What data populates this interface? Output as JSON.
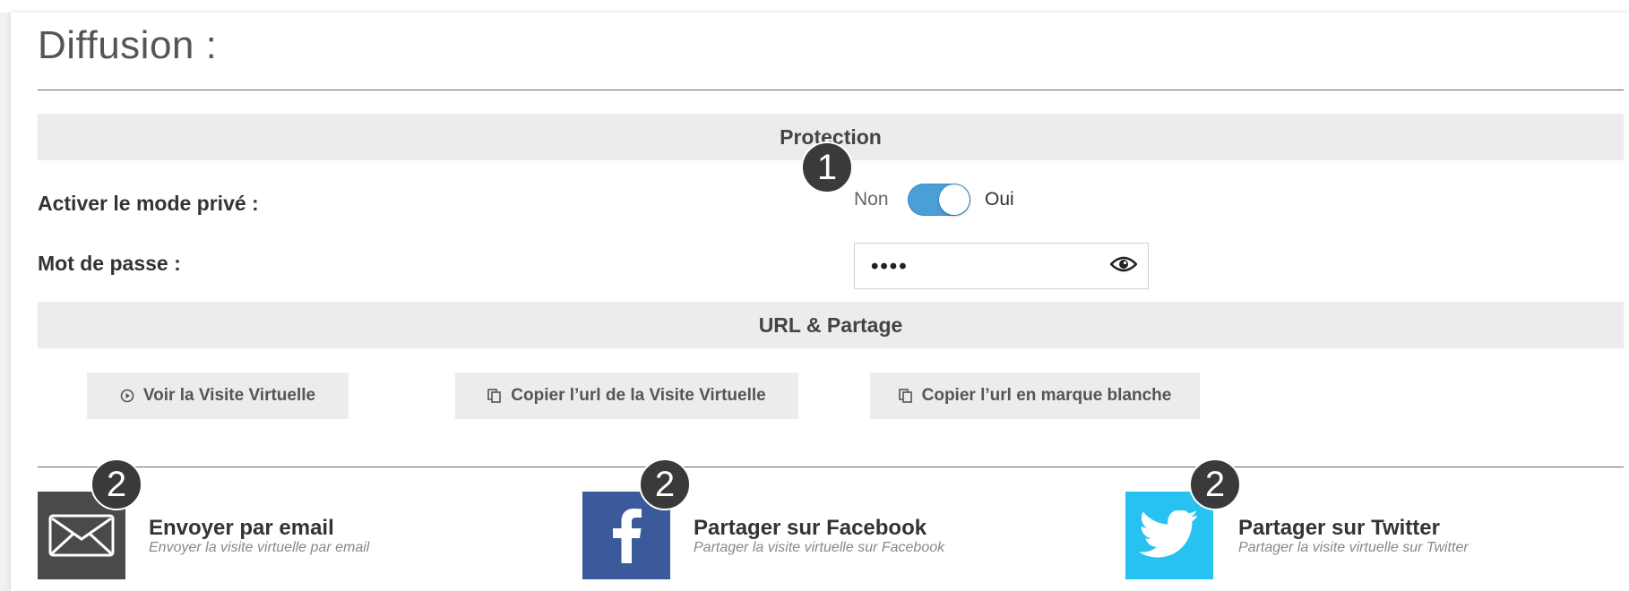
{
  "section_title": "Diffusion :",
  "protection": {
    "header": "Protection",
    "private_mode_label": "Activer le mode privé :",
    "toggle_off_label": "Non",
    "toggle_on_label": "Oui",
    "toggle_state": "on",
    "password_label": "Mot de passe :",
    "password_value": "••••"
  },
  "url_share": {
    "header": "URL & Partage",
    "buttons": [
      {
        "label": "Voir la Visite Virtuelle",
        "icon": "play-circle-icon"
      },
      {
        "label": "Copier l’url de la Visite Virtuelle",
        "icon": "copy-icon"
      },
      {
        "label": "Copier l’url en marque blanche",
        "icon": "copy-icon"
      }
    ]
  },
  "share": [
    {
      "title": "Envoyer par email",
      "subtitle": "Envoyer la visite virtuelle par email",
      "icon": "envelope-icon",
      "color": "#4a4a4a"
    },
    {
      "title": "Partager sur Facebook",
      "subtitle": "Partager la visite virtuelle sur Facebook",
      "icon": "facebook-icon",
      "color": "#3b5a9b"
    },
    {
      "title": "Partager sur Twitter",
      "subtitle": "Partager la visite virtuelle sur Twitter",
      "icon": "twitter-icon",
      "color": "#27c2f1"
    }
  ],
  "callouts": {
    "toggle": "1",
    "share": "2"
  },
  "colors": {
    "toggle_active": "#4aa0d6",
    "band_bg": "#ececee",
    "badge_bg": "#3a3a3a"
  }
}
